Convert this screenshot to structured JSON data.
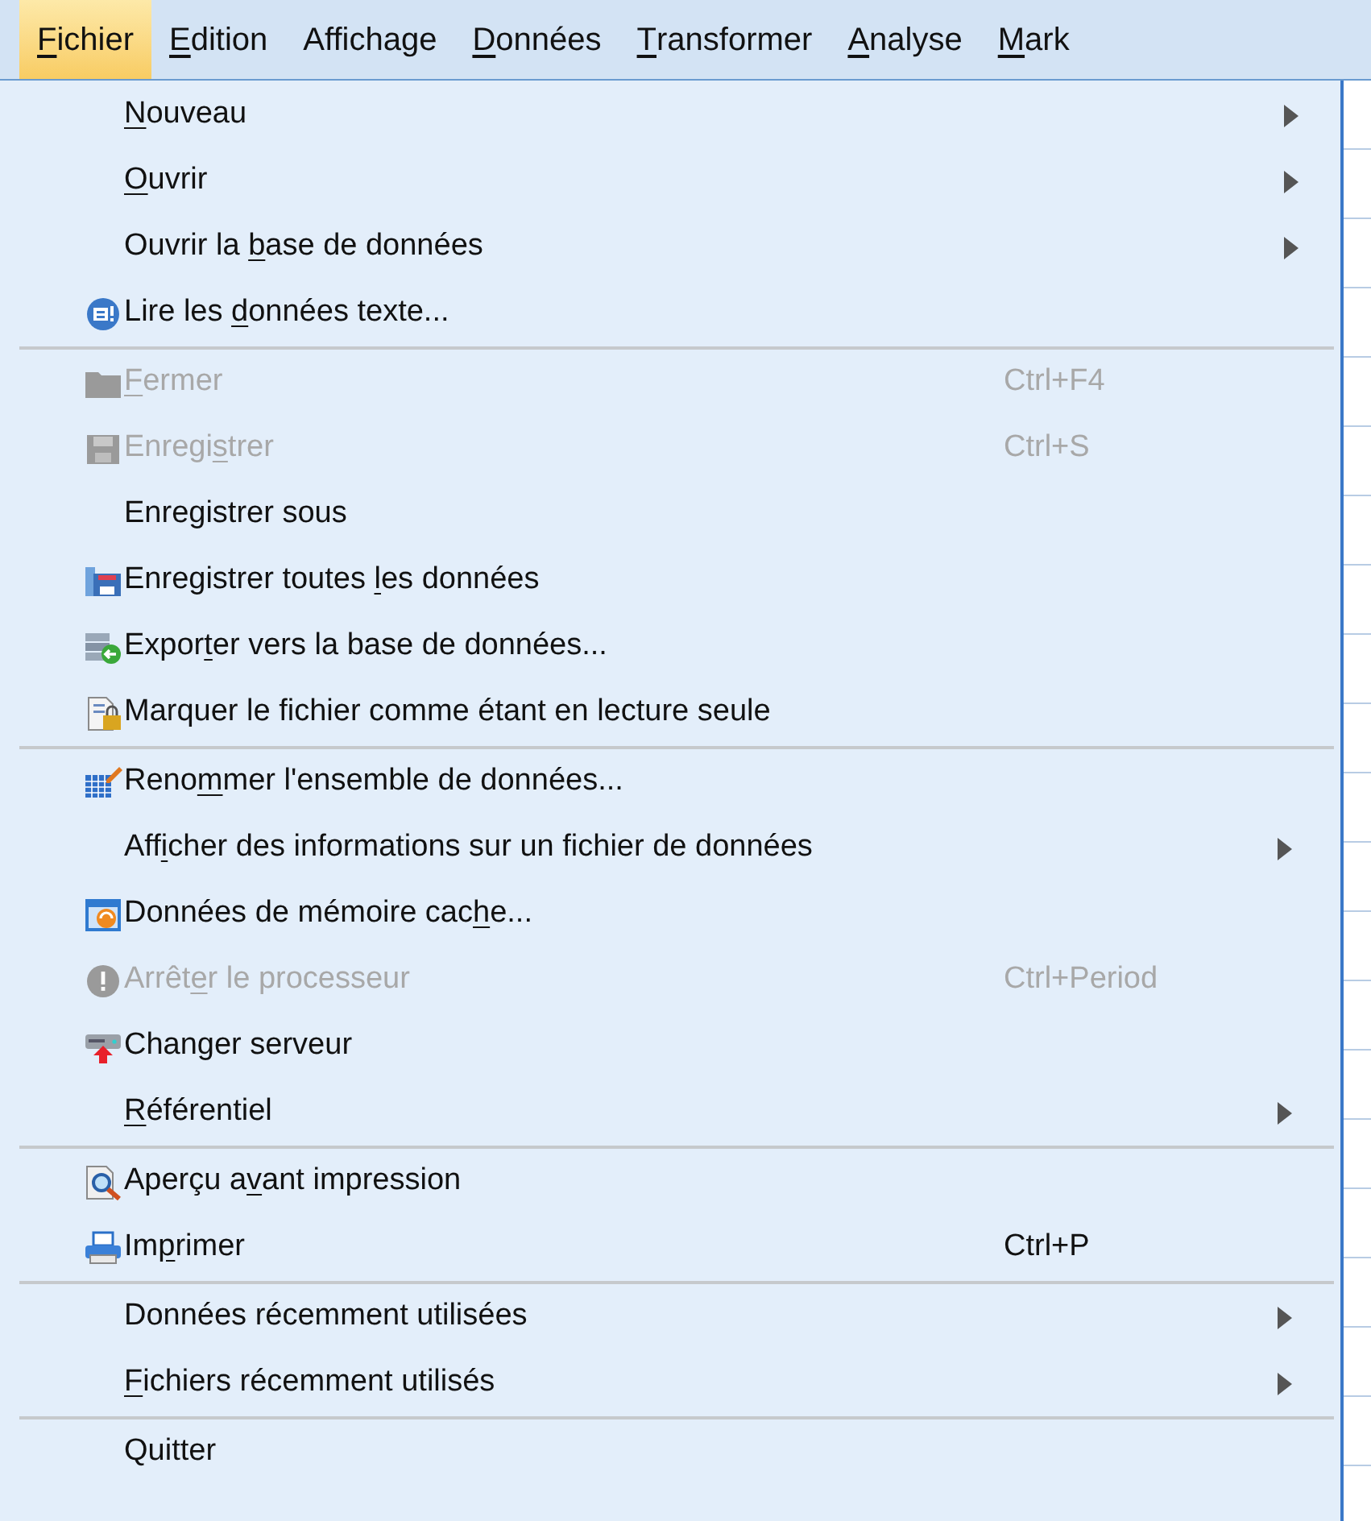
{
  "menu_bar": [
    {
      "key": "F",
      "post": "ichier",
      "selected": true
    },
    {
      "key": "E",
      "post": "dition",
      "selected": false
    },
    {
      "pre": "Affichage",
      "selected": false
    },
    {
      "key": "D",
      "post": "onnées",
      "selected": false
    },
    {
      "key": "T",
      "post": "ransformer",
      "selected": false
    },
    {
      "key": "A",
      "post": "nalyse",
      "selected": false
    },
    {
      "key": "M",
      "post": "ark",
      "selected": false
    }
  ],
  "file_menu": {
    "groups": [
      [
        {
          "key": "N",
          "post": "ouveau",
          "disabled": false,
          "submenu": true
        },
        {
          "key": "O",
          "post": "uvrir",
          "disabled": false,
          "submenu": true
        },
        {
          "pre": "Ouvrir la ",
          "key": "b",
          "post": "ase de données",
          "disabled": false,
          "submenu": true
        },
        {
          "pre": "Lire les ",
          "key": "d",
          "post": "onnées texte...",
          "disabled": false,
          "submenu": false
        }
      ],
      [
        {
          "key": "F",
          "post": "ermer",
          "shortcut": "Ctrl+F4",
          "disabled": true,
          "submenu": false
        },
        {
          "pre": "Enregi",
          "key": "s",
          "post": "trer",
          "shortcut": "Ctrl+S",
          "disabled": true,
          "submenu": false
        },
        {
          "pre": "Enregistrer sous",
          "disabled": false,
          "submenu": false
        },
        {
          "pre": "Enregistrer toutes ",
          "key": "l",
          "post": "es données",
          "disabled": false,
          "submenu": false
        },
        {
          "pre": "Expor",
          "key": "t",
          "post": "er vers la base de données...",
          "disabled": false,
          "submenu": false
        },
        {
          "pre": "Marquer le fichier comme étant en lecture seule",
          "disabled": false,
          "submenu": false
        }
      ],
      [
        {
          "pre": "Reno",
          "key": "m",
          "post": "mer l'ensemble de données...",
          "disabled": false,
          "submenu": false
        },
        {
          "pre": "Aff",
          "key": "i",
          "post": "cher des informations sur un fichier de données",
          "disabled": false,
          "submenu": true
        },
        {
          "pre": "Données de mémoire cac",
          "key": "h",
          "post": "e...",
          "disabled": false,
          "submenu": false
        },
        {
          "pre": "Arrêt",
          "key": "e",
          "post": "r le processeur",
          "shortcut": "Ctrl+Period",
          "disabled": true,
          "submenu": false
        },
        {
          "pre": "Changer serveur",
          "disabled": false,
          "submenu": false
        },
        {
          "key": "R",
          "post": "éférentiel",
          "disabled": false,
          "submenu": true
        }
      ],
      [
        {
          "pre": "Aperçu a",
          "key": "v",
          "post": "ant impression",
          "disabled": false,
          "submenu": false
        },
        {
          "pre": "Im",
          "key": "p",
          "post": "rimer",
          "shortcut": "Ctrl+P",
          "disabled": false,
          "submenu": false
        }
      ],
      [
        {
          "pre": "Données récemment utilisées",
          "disabled": false,
          "submenu": true
        },
        {
          "key": "F",
          "post": "ichiers récemment utilisés",
          "disabled": false,
          "submenu": true
        }
      ],
      [
        {
          "pre": "Quitter",
          "disabled": false,
          "submenu": false
        }
      ]
    ]
  }
}
